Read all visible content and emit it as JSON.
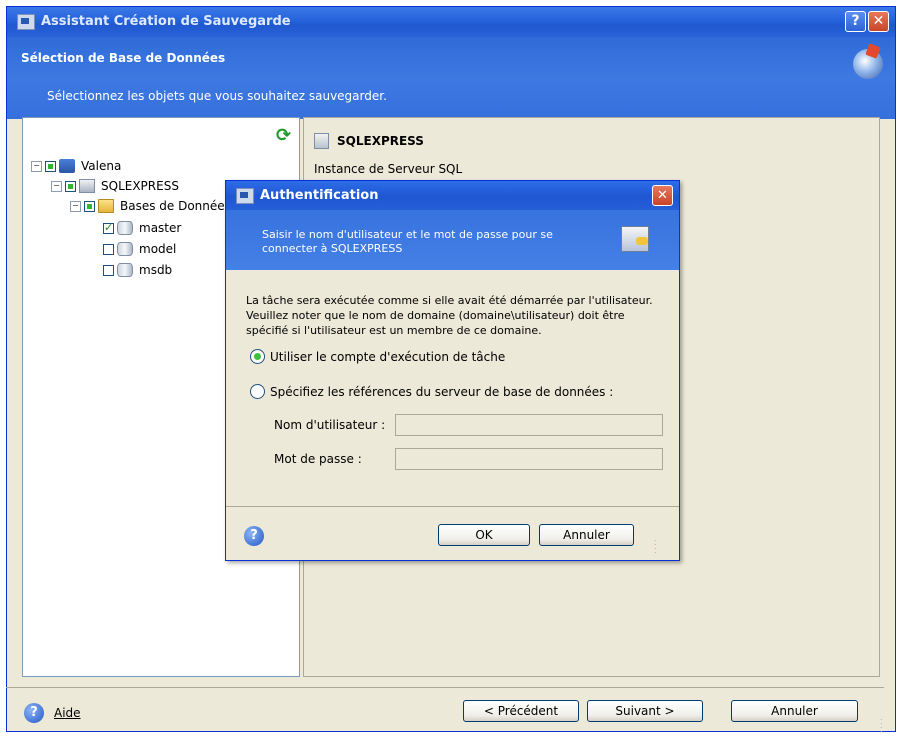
{
  "window": {
    "title": "Assistant Création de Sauvegarde",
    "help_glyph": "?",
    "close_glyph": "✕",
    "header_title": "Sélection de Base de Données",
    "header_subtitle": "Sélectionnez les objets que vous souhaitez sauvegarder."
  },
  "tree": {
    "items": [
      {
        "label": "Valena",
        "expander": "−"
      },
      {
        "label": "SQLEXPRESS",
        "expander": "−"
      },
      {
        "label": "Bases de Données",
        "expander": "−"
      },
      {
        "label": "master",
        "checked": true
      },
      {
        "label": "model",
        "checked": false
      },
      {
        "label": "msdb",
        "checked": false
      }
    ]
  },
  "details": {
    "title": "SQLEXPRESS",
    "description": "Instance de Serveur SQL"
  },
  "dialog": {
    "title": "Authentification",
    "close_glyph": "✕",
    "header_text": "Saisir le nom d'utilisateur et le mot de passe pour se connecter à SQLEXPRESS",
    "paragraph": "La tâche sera exécutée comme si elle avait été démarrée par l'utilisateur. Veuillez noter que le nom de domaine (domaine\\utilisateur) doit être spécifié si l'utilisateur est un membre de ce domaine.",
    "radio_task_account": "Utiliser le compte d'exécution de tâche",
    "radio_credentials": "Spécifiez les références du serveur de base de données :",
    "username_label": "Nom d'utilisateur :",
    "password_label": "Mot de passe :",
    "username_value": "",
    "password_value": "",
    "ok_label": "OK",
    "cancel_label": "Annuler",
    "help_glyph": "?"
  },
  "footer": {
    "help_label": "Aide",
    "help_glyph": "?",
    "previous_label": "< Précédent",
    "next_label": "Suivant >",
    "cancel_label": "Annuler"
  },
  "icons": {
    "refresh": "refresh-icon",
    "wizard": "backup-wizard-icon",
    "key": "credentials-key-icon"
  },
  "colors": {
    "titlebar": "#2463da",
    "header": "#3e79e2",
    "window_bg": "#ece9d8",
    "close_red": "#c8452a",
    "check_green": "#2eb82e"
  }
}
